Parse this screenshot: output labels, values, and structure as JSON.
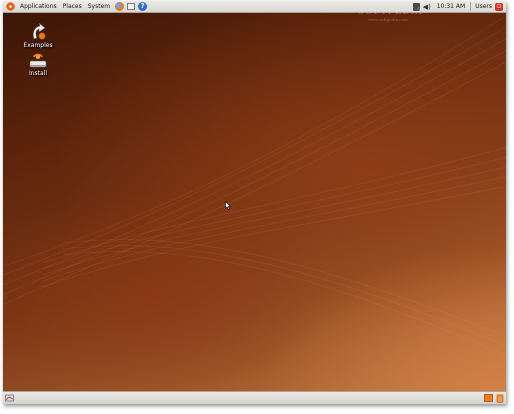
{
  "top_panel": {
    "menus": [
      "Applications",
      "Places",
      "System"
    ],
    "launchers": [
      "firefox-icon",
      "mail-icon",
      "help-icon"
    ],
    "clock": "10:31 AM",
    "user": "Users"
  },
  "watermark": {
    "title": "SOFTPEDIA",
    "url": "www.softpedia.com"
  },
  "desktop": {
    "icons": [
      {
        "label": "Examples",
        "icon": "examples-icon"
      },
      {
        "label": "Install",
        "icon": "install-icon"
      }
    ]
  },
  "bottom_panel": {
    "items": [
      "show-desktop-icon",
      "workspace-switcher",
      "trash-icon"
    ]
  },
  "colors": {
    "panel": "#dedcd8",
    "desktop_dark": "#3c1606",
    "desktop_light": "#c07a44",
    "accent": "#f07a22"
  }
}
